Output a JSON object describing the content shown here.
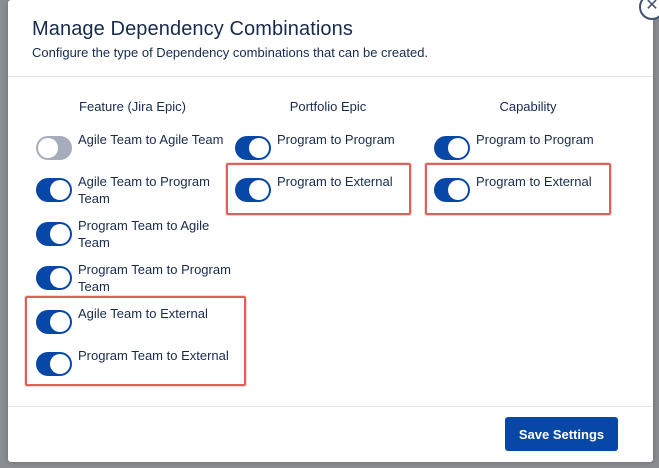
{
  "modal": {
    "title": "Manage Dependency Combinations",
    "subtitle": "Configure the type of Dependency combinations that can be created."
  },
  "columns": [
    {
      "header": "Feature (Jira Epic)",
      "toggles": [
        {
          "label": "Agile Team to Agile Team",
          "on": false
        },
        {
          "label": "Agile Team to Program Team",
          "on": true
        },
        {
          "label": "Program Team to Agile Team",
          "on": true
        },
        {
          "label": "Program Team to Program Team",
          "on": true
        },
        {
          "label": "Agile Team to External",
          "on": true
        },
        {
          "label": "Program Team to External",
          "on": true
        }
      ]
    },
    {
      "header": "Portfolio Epic",
      "toggles": [
        {
          "label": "Program to Program",
          "on": true
        },
        {
          "label": "Program to External",
          "on": true
        }
      ]
    },
    {
      "header": "Capability",
      "toggles": [
        {
          "label": "Program to Program",
          "on": true
        },
        {
          "label": "Program to External",
          "on": true
        }
      ]
    }
  ],
  "footer": {
    "save_label": "Save Settings"
  },
  "colors": {
    "primary": "#0747a6",
    "toggle_off": "#a5adba",
    "highlight": "#e0605a",
    "text": "#172b4d"
  },
  "icons": {
    "close": "close-icon"
  }
}
